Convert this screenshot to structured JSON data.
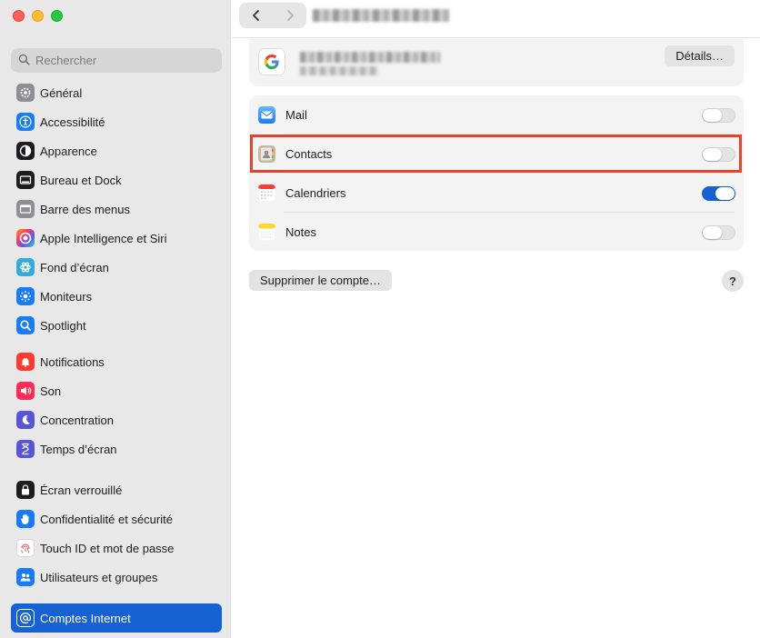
{
  "sidebar": {
    "search": {
      "placeholder": "Rechercher"
    },
    "groups": [
      [
        {
          "label": "Général",
          "icon": "gear-icon",
          "color": "#8e8e93"
        },
        {
          "label": "Accessibilité",
          "icon": "accessibility-icon",
          "color": "#1a7cf5"
        },
        {
          "label": "Apparence",
          "icon": "appearance-icon",
          "color": "#1d1d1f"
        },
        {
          "label": "Bureau et Dock",
          "icon": "dock-icon",
          "color": "#1d1d1f"
        },
        {
          "label": "Barre des menus",
          "icon": "menubar-icon",
          "color": "#8e8e93"
        },
        {
          "label": "Apple Intelligence et Siri",
          "icon": "siri-icon",
          "color": "#f06292"
        },
        {
          "label": "Fond d’écran",
          "icon": "wallpaper-icon",
          "color": "#34aadc"
        },
        {
          "label": "Moniteurs",
          "icon": "display-icon",
          "color": "#1a7cf5"
        },
        {
          "label": "Spotlight",
          "icon": "spotlight-icon",
          "color": "#1a7cf5"
        }
      ],
      [
        {
          "label": "Notifications",
          "icon": "notifications-icon",
          "color": "#ff3b30"
        },
        {
          "label": "Son",
          "icon": "sound-icon",
          "color": "#ff2d55"
        },
        {
          "label": "Concentration",
          "icon": "focus-icon",
          "color": "#5856d6"
        },
        {
          "label": "Temps d’écran",
          "icon": "screentime-icon",
          "color": "#5856d6"
        }
      ],
      [
        {
          "label": "Écran verrouillé",
          "icon": "lock-icon",
          "color": "#1d1d1f"
        },
        {
          "label": "Confidentialité et sécurité",
          "icon": "privacy-hand-icon",
          "color": "#1a7cf5"
        },
        {
          "label": "Touch ID et mot de passe",
          "icon": "fingerprint-icon",
          "color": "#ffffff"
        },
        {
          "label": "Utilisateurs et groupes",
          "icon": "users-icon",
          "color": "#1a7cf5"
        }
      ],
      [
        {
          "label": "Comptes Internet",
          "icon": "at-icon",
          "color": "#1a7cf5",
          "active": true
        }
      ]
    ]
  },
  "account": {
    "details_label": "Détails…"
  },
  "services": [
    {
      "label": "Mail",
      "icon": "mail-icon",
      "enabled": false
    },
    {
      "label": "Contacts",
      "icon": "contacts-icon",
      "enabled": false,
      "highlighted": true
    },
    {
      "label": "Calendriers",
      "icon": "calendar-icon",
      "enabled": true
    },
    {
      "label": "Notes",
      "icon": "notes-icon",
      "enabled": false
    }
  ],
  "footer": {
    "delete_label": "Supprimer le compte…",
    "help_label": "?"
  },
  "colors": {
    "accent": "#1662d4",
    "highlight": "#e2452c"
  }
}
